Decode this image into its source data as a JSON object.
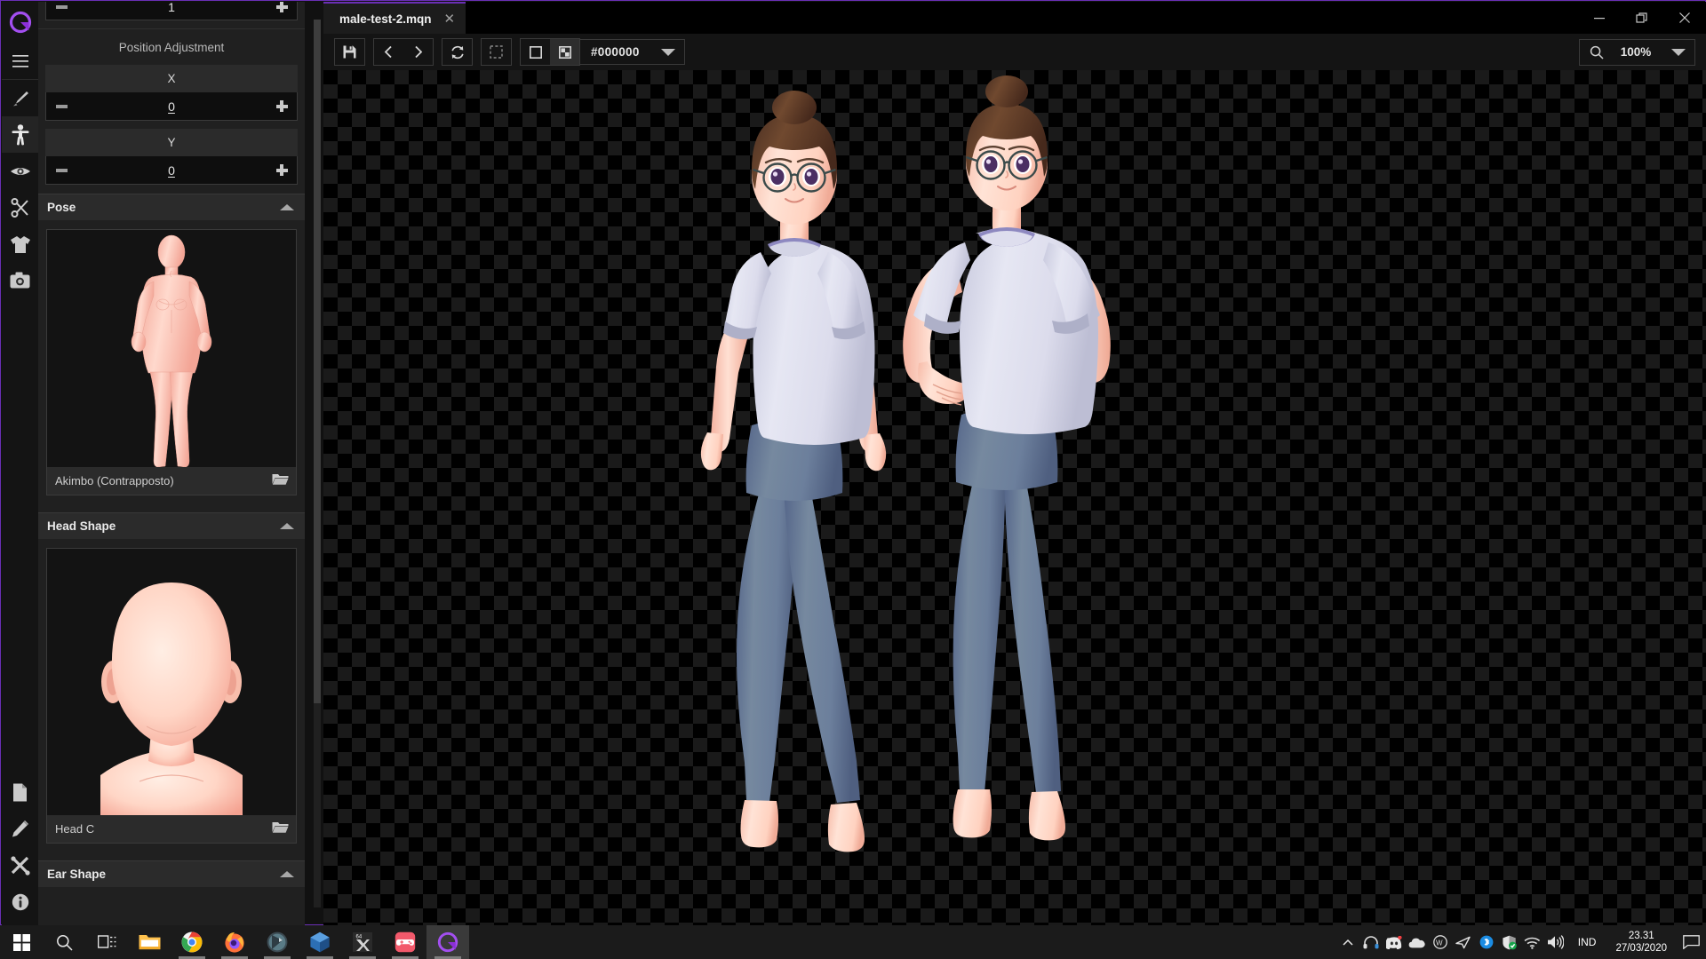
{
  "app": {
    "logo_icon": "q-logo-icon"
  },
  "rail": {
    "items": [
      {
        "name": "menu-icon",
        "label": "Menu"
      },
      {
        "name": "brush-icon",
        "label": "Brush"
      },
      {
        "name": "body-icon",
        "label": "Body"
      },
      {
        "name": "eye-icon",
        "label": "Eye"
      },
      {
        "name": "scissors-icon",
        "label": "Hair"
      },
      {
        "name": "shirt-icon",
        "label": "Clothing"
      },
      {
        "name": "camera-icon",
        "label": "Camera"
      }
    ],
    "bottom_items": [
      {
        "name": "document-icon",
        "label": "Document"
      },
      {
        "name": "pencil-icon",
        "label": "Edit"
      },
      {
        "name": "tools-icon",
        "label": "Tools"
      },
      {
        "name": "info-icon",
        "label": "Info"
      }
    ]
  },
  "panel": {
    "top_spinner": {
      "value": "1"
    },
    "position_adjustment": {
      "title": "Position Adjustment",
      "fields": [
        {
          "label": "X",
          "value": "0"
        },
        {
          "label": "Y",
          "value": "0"
        }
      ]
    },
    "sections": [
      {
        "title": "Pose",
        "item_name": "Akimbo (Contrapposto)",
        "folder_icon": "folder-open-icon"
      },
      {
        "title": "Head Shape",
        "item_name": "Head C",
        "folder_icon": "folder-open-icon"
      },
      {
        "title": "Ear Shape",
        "item_name": "",
        "folder_icon": "folder-open-icon"
      }
    ]
  },
  "titlebar": {
    "tab": {
      "label": "male-test-2.mqn",
      "close_icon": "close-icon"
    },
    "window_controls": {
      "minimize": "minimize-icon",
      "restore": "restore-icon",
      "close": "close-icon"
    }
  },
  "toolbar": {
    "save_icon": "save-icon",
    "prev_icon": "chevron-left-icon",
    "next_icon": "chevron-right-icon",
    "refresh_icon": "refresh-icon",
    "marquee_icon": "marquee-select-icon",
    "solid_bg_icon": "solid-background-icon",
    "checker_bg_icon": "checker-background-icon",
    "background_color": "#000000",
    "dropdown_icon": "chevron-down-icon",
    "zoom": {
      "search_icon": "magnifier-icon",
      "value": "100%",
      "dropdown_icon": "chevron-down-icon"
    }
  },
  "canvas": {
    "characters": [
      {
        "name": "character-left",
        "pose": "standing-relaxed",
        "glasses": true,
        "hair": "brown-bun",
        "top_color": "#d8d8ea",
        "pants_color": "#6b7e9e"
      },
      {
        "name": "character-right",
        "pose": "akimbo-hands-on-hips",
        "glasses": true,
        "hair": "brown-bun",
        "top_color": "#dcdcee",
        "pants_color": "#6b7e9e"
      }
    ]
  },
  "taskbar": {
    "start_icon": "windows-start-icon",
    "search_icon": "search-icon",
    "taskview_icon": "task-view-icon",
    "apps": [
      {
        "name": "file-explorer-icon"
      },
      {
        "name": "google-chrome-icon"
      },
      {
        "name": "firefox-icon"
      },
      {
        "name": "opera-icon"
      },
      {
        "name": "blender-icon"
      },
      {
        "name": "x64-app-icon"
      },
      {
        "name": "game-controller-icon"
      },
      {
        "name": "q-app-icon"
      }
    ],
    "tray": [
      {
        "name": "chevron-up-icon"
      },
      {
        "name": "headphones-icon"
      },
      {
        "name": "discord-icon"
      },
      {
        "name": "onedrive-icon"
      },
      {
        "name": "w-app-icon"
      },
      {
        "name": "plane-icon"
      },
      {
        "name": "bluetooth-icon"
      },
      {
        "name": "windows-defender-icon"
      },
      {
        "name": "wifi-icon"
      },
      {
        "name": "volume-icon"
      }
    ],
    "language": "IND",
    "time": "23.31",
    "date": "27/03/2020",
    "notification_icon": "notification-icon"
  },
  "colors": {
    "accent": "#6a2fb5",
    "panel_bg": "#202020",
    "rail_bg": "#141414",
    "checker_dark": "#000000",
    "checker_light": "#1a1a1a"
  }
}
